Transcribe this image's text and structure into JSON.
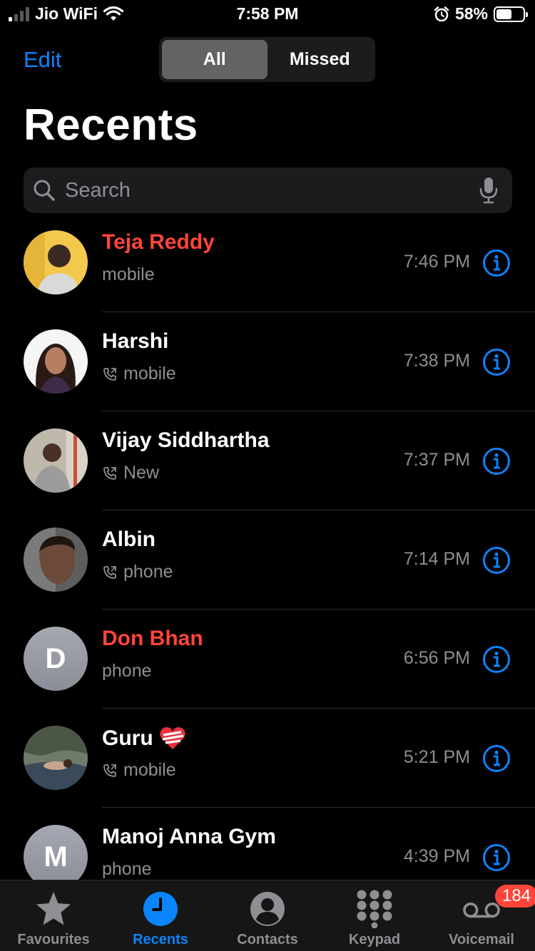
{
  "status_bar": {
    "carrier": "Jio WiFi",
    "time": "7:58 PM",
    "battery_percent": "58%",
    "battery_level": 0.58,
    "signal_bars_filled": 1,
    "signal_bars_total": 4,
    "icons": [
      "signal-icon",
      "wifi-icon",
      "alarm-icon",
      "battery-icon"
    ]
  },
  "header": {
    "edit_label": "Edit",
    "segments": [
      "All",
      "Missed"
    ],
    "selected_segment": "All",
    "title": "Recents"
  },
  "search": {
    "placeholder": "Search",
    "value": ""
  },
  "calls": [
    {
      "name": "Teja Reddy",
      "subtitle": "mobile",
      "time": "7:46 PM",
      "missed": true,
      "outgoing_icon": false,
      "avatar": "photo",
      "emoji": ""
    },
    {
      "name": "Harshi",
      "subtitle": "mobile",
      "time": "7:38 PM",
      "missed": false,
      "outgoing_icon": true,
      "avatar": "photo",
      "emoji": ""
    },
    {
      "name": "Vijay Siddhartha",
      "subtitle": "New",
      "time": "7:37 PM",
      "missed": false,
      "outgoing_icon": true,
      "avatar": "photo",
      "emoji": ""
    },
    {
      "name": "Albin",
      "subtitle": "phone",
      "time": "7:14 PM",
      "missed": false,
      "outgoing_icon": true,
      "avatar": "photo",
      "emoji": ""
    },
    {
      "name": "Don Bhan",
      "subtitle": "phone",
      "time": "6:56 PM",
      "missed": true,
      "outgoing_icon": false,
      "avatar": "initial",
      "initial": "D",
      "emoji": ""
    },
    {
      "name": "Guru",
      "subtitle": "mobile",
      "time": "5:21 PM",
      "missed": false,
      "outgoing_icon": true,
      "avatar": "photo",
      "emoji": "❤️‍🩹"
    },
    {
      "name": "Manoj Anna Gym",
      "subtitle": "phone",
      "time": "4:39 PM",
      "missed": false,
      "outgoing_icon": false,
      "avatar": "initial",
      "initial": "M",
      "emoji": ""
    }
  ],
  "tab_bar": {
    "tabs": [
      {
        "label": "Favourites",
        "icon": "star-icon",
        "active": false
      },
      {
        "label": "Recents",
        "icon": "clock-icon",
        "active": true
      },
      {
        "label": "Contacts",
        "icon": "person-circle-icon",
        "active": false
      },
      {
        "label": "Keypad",
        "icon": "keypad-icon",
        "active": false
      },
      {
        "label": "Voicemail",
        "icon": "voicemail-icon",
        "active": false,
        "badge": "184"
      }
    ]
  },
  "colors": {
    "accent": "#0a84ff",
    "missed": "#ff453a",
    "secondary_text": "#8e8e93",
    "background": "#000000"
  }
}
